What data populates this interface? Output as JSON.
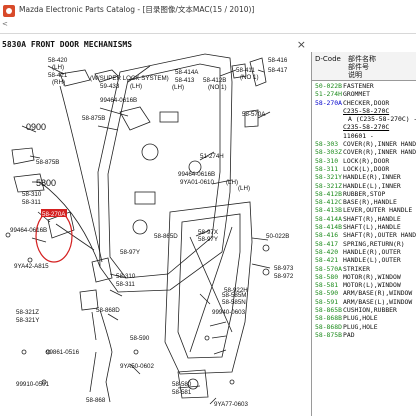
{
  "window": {
    "title": "Mazda Electronic Parts Catalog - [目录图像/文本MAC(15 / 2010)]",
    "toolbar_caption": "<"
  },
  "page": {
    "title": "5830A  FRONT DOOR MECHANISMS",
    "close_glyph": "×"
  },
  "panel": {
    "code_header": "D-Code",
    "name_header": "部件名称\n部件号\n说明"
  },
  "callouts": {
    "c01": "58-420",
    "c02": "(LH)",
    "c03": "58-421",
    "c04": "(RH)",
    "c05": "(W/SUPER LOCK SYSTEM)",
    "c06": "59-433",
    "c07": "(LH)",
    "c08": "58-414A",
    "c09": "58-413",
    "c10": "(LH)",
    "c11": "58-412B",
    "c12": "(NO 1)",
    "c13": "58-411",
    "c14": "(NO 1)",
    "c15": "58-416",
    "c16": "58-417",
    "c17": "99464-0616B",
    "c18": "58-875B",
    "c19": "0900",
    "c20": "58-570A",
    "c21": "51-274H",
    "c22": "58-875B",
    "c23": "99464-0616B",
    "c24": "(LH)",
    "c25": "9YA01-0610",
    "c26": "(LH)",
    "c27": "5800",
    "c28": "58-310",
    "c29": "58-311",
    "c30": "58-270A",
    "c31": "99464-0616B",
    "c32": "9YA42-A815",
    "c33": "58-865D",
    "c34": "58-97X",
    "c35": "58-97Y",
    "c36": "50-022B",
    "c37": "58-973",
    "c38": "58-972",
    "c39": "58-922H",
    "c40": "58-97Y",
    "c41": "58-310",
    "c42": "58-311",
    "c43": "58-868D",
    "c44": "58-321Z",
    "c45": "58-321Y",
    "c46": "99940-0603",
    "c47": "58-585M",
    "c48": "58-585N",
    "c49": "58-590",
    "c50": "99861-0516",
    "c51": "9YA50-0602",
    "c52": "99910-0501",
    "c53": "58-580",
    "c54": "58-581",
    "c55": "9YA77-0603",
    "c56": "58-868"
  },
  "parts": [
    {
      "code": "50-022B",
      "name": "FASTENER"
    },
    {
      "code": "51-274H",
      "name": "GROMMET"
    },
    {
      "code": "58-270A",
      "name": "CHECKER,DOOR"
    },
    {
      "code": "",
      "name": "C235-58-270C"
    },
    {
      "code": "",
      "name": "A (C235-58-270C) - 110601"
    },
    {
      "code": "",
      "name": "C235-58-270C"
    },
    {
      "code": "",
      "name": "110601 -"
    },
    {
      "code": "58-303",
      "name": "COVER(R),INNER HANDLE"
    },
    {
      "code": "58-303Z",
      "name": "COVER(R),INNER HANDLE"
    },
    {
      "code": "58-310",
      "name": "LOCK(R),DOOR"
    },
    {
      "code": "58-311",
      "name": "LOCK(L),DOOR"
    },
    {
      "code": "58-321Y",
      "name": "HANDLE(R),INNER"
    },
    {
      "code": "58-321Z",
      "name": "HANDLE(L),INNER"
    },
    {
      "code": "58-412B",
      "name": "RUBBER,STOP"
    },
    {
      "code": "58-412C",
      "name": "BASE(R),HANDLE"
    },
    {
      "code": "58-413B",
      "name": "LEVER,OUTER HANDLE"
    },
    {
      "code": "58-414A",
      "name": "SHAFT(R),HANDLE"
    },
    {
      "code": "58-414B",
      "name": "SHAFT(L),HANDLE"
    },
    {
      "code": "58-416",
      "name": "SHAFT(R),OUTER HANDLE"
    },
    {
      "code": "58-417",
      "name": "SPRING,RETURN(R)"
    },
    {
      "code": "58-420",
      "name": "HANDLE(R),OUTER"
    },
    {
      "code": "58-421",
      "name": "HANDLE(L),OUTER"
    },
    {
      "code": "58-570A",
      "name": "STRIKER"
    },
    {
      "code": "58-580",
      "name": "MOTOR(R),WINDOW"
    },
    {
      "code": "58-581",
      "name": "MOTOR(L),WINDOW"
    },
    {
      "code": "58-590",
      "name": "ARM/BASE(R),WINDOW"
    },
    {
      "code": "58-591",
      "name": "ARM/BASE(L),WINDOW"
    },
    {
      "code": "58-865B",
      "name": "CUSHION,RUBBER"
    },
    {
      "code": "58-868B",
      "name": "PLUG,HOLE"
    },
    {
      "code": "58-868D",
      "name": "PLUG,HOLE"
    },
    {
      "code": "58-875B",
      "name": "PAD"
    }
  ],
  "colors": {
    "code_green": "#1a8a1a",
    "selected_blue": "#0000cc",
    "highlight_red": "#d42020"
  }
}
